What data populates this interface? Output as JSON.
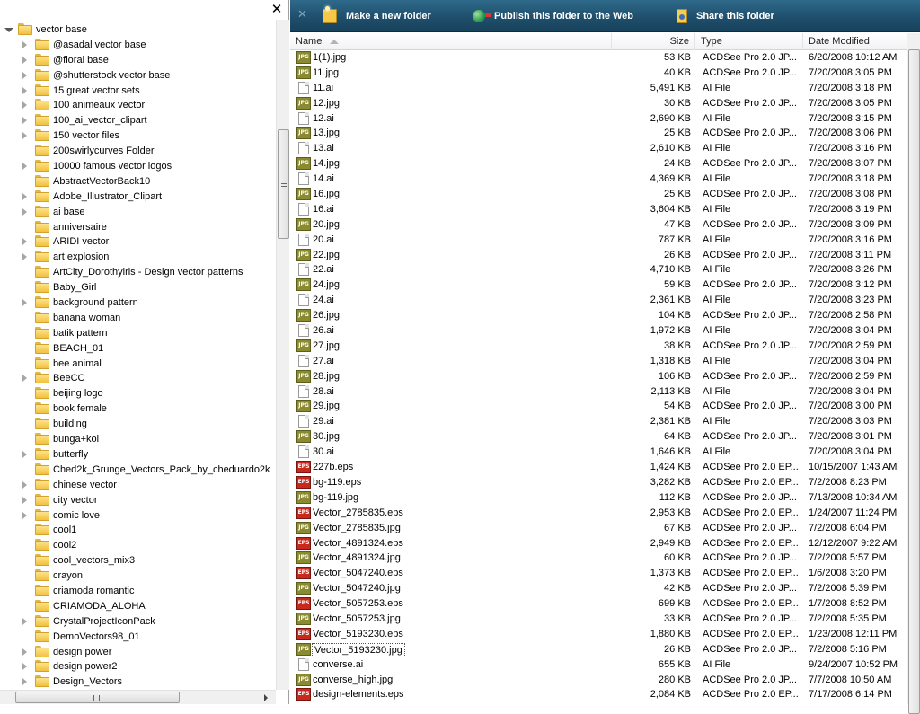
{
  "tree": {
    "close_glyph": "✕",
    "root_label": "vector base",
    "items": [
      {
        "label": "@asadal vector base",
        "expandable": true
      },
      {
        "label": "@floral base",
        "expandable": true
      },
      {
        "label": "@shutterstock vector base",
        "expandable": true
      },
      {
        "label": "15 great vector sets",
        "expandable": true
      },
      {
        "label": "100 animeaux vector",
        "expandable": true
      },
      {
        "label": "100_ai_vector_clipart",
        "expandable": true
      },
      {
        "label": "150 vector files",
        "expandable": true
      },
      {
        "label": "200swirlycurves Folder",
        "expandable": false
      },
      {
        "label": "10000 famous vector logos",
        "expandable": true
      },
      {
        "label": "AbstractVectorBack10",
        "expandable": false
      },
      {
        "label": "Adobe_Illustrator_Clipart",
        "expandable": true
      },
      {
        "label": "ai base",
        "expandable": true
      },
      {
        "label": "anniversaire",
        "expandable": false
      },
      {
        "label": "ARIDI vector",
        "expandable": true
      },
      {
        "label": "art explosion",
        "expandable": true
      },
      {
        "label": "ArtCity_Dorothyiris - Design vector patterns",
        "expandable": false
      },
      {
        "label": "Baby_Girl",
        "expandable": false
      },
      {
        "label": "background pattern",
        "expandable": true
      },
      {
        "label": "banana woman",
        "expandable": false
      },
      {
        "label": "batik pattern",
        "expandable": false
      },
      {
        "label": "BEACH_01",
        "expandable": false
      },
      {
        "label": "bee animal",
        "expandable": false
      },
      {
        "label": "BeeCC",
        "expandable": true
      },
      {
        "label": "beijing logo",
        "expandable": false
      },
      {
        "label": "book female",
        "expandable": false
      },
      {
        "label": "building",
        "expandable": false
      },
      {
        "label": "bunga+koi",
        "expandable": false
      },
      {
        "label": "butterfly",
        "expandable": true
      },
      {
        "label": "Ched2k_Grunge_Vectors_Pack_by_cheduardo2k",
        "expandable": false
      },
      {
        "label": "chinese vector",
        "expandable": true
      },
      {
        "label": "city vector",
        "expandable": true
      },
      {
        "label": "comic love",
        "expandable": true
      },
      {
        "label": "cool1",
        "expandable": false
      },
      {
        "label": "cool2",
        "expandable": false
      },
      {
        "label": "cool_vectors_mix3",
        "expandable": false
      },
      {
        "label": "crayon",
        "expandable": false
      },
      {
        "label": "criamoda romantic",
        "expandable": false
      },
      {
        "label": "CRIAMODA_ALOHA",
        "expandable": false
      },
      {
        "label": "CrystalProjectIconPack",
        "expandable": true
      },
      {
        "label": "DemoVectors98_01",
        "expandable": false
      },
      {
        "label": "design power",
        "expandable": true
      },
      {
        "label": "design power2",
        "expandable": true
      },
      {
        "label": "Design_Vectors",
        "expandable": true
      }
    ]
  },
  "command_bar": {
    "close_glyph": "✕",
    "items": [
      {
        "label": "Make a new folder",
        "icon": "new-folder-icon"
      },
      {
        "label": "Publish this folder to the Web",
        "icon": "publish-web-icon"
      },
      {
        "label": "Share this folder",
        "icon": "share-folder-icon"
      }
    ]
  },
  "columns": {
    "name": "Name",
    "size": "Size",
    "type": "Type",
    "date": "Date Modified"
  },
  "files": [
    {
      "name": "1(1).jpg",
      "icon": "jpg",
      "size": "53 KB",
      "type": "ACDSee Pro 2.0 JP...",
      "date": "6/20/2008 10:12 AM"
    },
    {
      "name": "11.jpg",
      "icon": "jpg",
      "size": "40 KB",
      "type": "ACDSee Pro 2.0 JP...",
      "date": "7/20/2008 3:05 PM"
    },
    {
      "name": "11.ai",
      "icon": "ai",
      "size": "5,491 KB",
      "type": "AI File",
      "date": "7/20/2008 3:18 PM"
    },
    {
      "name": "12.jpg",
      "icon": "jpg",
      "size": "30 KB",
      "type": "ACDSee Pro 2.0 JP...",
      "date": "7/20/2008 3:05 PM"
    },
    {
      "name": "12.ai",
      "icon": "ai",
      "size": "2,690 KB",
      "type": "AI File",
      "date": "7/20/2008 3:15 PM"
    },
    {
      "name": "13.jpg",
      "icon": "jpg",
      "size": "25 KB",
      "type": "ACDSee Pro 2.0 JP...",
      "date": "7/20/2008 3:06 PM"
    },
    {
      "name": "13.ai",
      "icon": "ai",
      "size": "2,610 KB",
      "type": "AI File",
      "date": "7/20/2008 3:16 PM"
    },
    {
      "name": "14.jpg",
      "icon": "jpg",
      "size": "24 KB",
      "type": "ACDSee Pro 2.0 JP...",
      "date": "7/20/2008 3:07 PM"
    },
    {
      "name": "14.ai",
      "icon": "ai",
      "size": "4,369 KB",
      "type": "AI File",
      "date": "7/20/2008 3:18 PM"
    },
    {
      "name": "16.jpg",
      "icon": "jpg",
      "size": "25 KB",
      "type": "ACDSee Pro 2.0 JP...",
      "date": "7/20/2008 3:08 PM"
    },
    {
      "name": "16.ai",
      "icon": "ai",
      "size": "3,604 KB",
      "type": "AI File",
      "date": "7/20/2008 3:19 PM"
    },
    {
      "name": "20.jpg",
      "icon": "jpg",
      "size": "47 KB",
      "type": "ACDSee Pro 2.0 JP...",
      "date": "7/20/2008 3:09 PM"
    },
    {
      "name": "20.ai",
      "icon": "ai",
      "size": "787 KB",
      "type": "AI File",
      "date": "7/20/2008 3:16 PM"
    },
    {
      "name": "22.jpg",
      "icon": "jpg",
      "size": "26 KB",
      "type": "ACDSee Pro 2.0 JP...",
      "date": "7/20/2008 3:11 PM"
    },
    {
      "name": "22.ai",
      "icon": "ai",
      "size": "4,710 KB",
      "type": "AI File",
      "date": "7/20/2008 3:26 PM"
    },
    {
      "name": "24.jpg",
      "icon": "jpg",
      "size": "59 KB",
      "type": "ACDSee Pro 2.0 JP...",
      "date": "7/20/2008 3:12 PM"
    },
    {
      "name": "24.ai",
      "icon": "ai",
      "size": "2,361 KB",
      "type": "AI File",
      "date": "7/20/2008 3:23 PM"
    },
    {
      "name": "26.jpg",
      "icon": "jpg",
      "size": "104 KB",
      "type": "ACDSee Pro 2.0 JP...",
      "date": "7/20/2008 2:58 PM"
    },
    {
      "name": "26.ai",
      "icon": "ai",
      "size": "1,972 KB",
      "type": "AI File",
      "date": "7/20/2008 3:04 PM"
    },
    {
      "name": "27.jpg",
      "icon": "jpg",
      "size": "38 KB",
      "type": "ACDSee Pro 2.0 JP...",
      "date": "7/20/2008 2:59 PM"
    },
    {
      "name": "27.ai",
      "icon": "ai",
      "size": "1,318 KB",
      "type": "AI File",
      "date": "7/20/2008 3:04 PM"
    },
    {
      "name": "28.jpg",
      "icon": "jpg",
      "size": "106 KB",
      "type": "ACDSee Pro 2.0 JP...",
      "date": "7/20/2008 2:59 PM"
    },
    {
      "name": "28.ai",
      "icon": "ai",
      "size": "2,113 KB",
      "type": "AI File",
      "date": "7/20/2008 3:04 PM"
    },
    {
      "name": "29.jpg",
      "icon": "jpg",
      "size": "54 KB",
      "type": "ACDSee Pro 2.0 JP...",
      "date": "7/20/2008 3:00 PM"
    },
    {
      "name": "29.ai",
      "icon": "ai",
      "size": "2,381 KB",
      "type": "AI File",
      "date": "7/20/2008 3:03 PM"
    },
    {
      "name": "30.jpg",
      "icon": "jpg",
      "size": "64 KB",
      "type": "ACDSee Pro 2.0 JP...",
      "date": "7/20/2008 3:01 PM"
    },
    {
      "name": "30.ai",
      "icon": "ai",
      "size": "1,646 KB",
      "type": "AI File",
      "date": "7/20/2008 3:04 PM"
    },
    {
      "name": "227b.eps",
      "icon": "eps",
      "size": "1,424 KB",
      "type": "ACDSee Pro 2.0 EP...",
      "date": "10/15/2007 1:43 AM"
    },
    {
      "name": "bg-119.eps",
      "icon": "eps",
      "size": "3,282 KB",
      "type": "ACDSee Pro 2.0 EP...",
      "date": "7/2/2008 8:23 PM"
    },
    {
      "name": "bg-119.jpg",
      "icon": "jpg",
      "size": "112 KB",
      "type": "ACDSee Pro 2.0 JP...",
      "date": "7/13/2008 10:34 AM"
    },
    {
      "name": "Vector_2785835.eps",
      "icon": "eps",
      "size": "2,953 KB",
      "type": "ACDSee Pro 2.0 EP...",
      "date": "1/24/2007 11:24 PM"
    },
    {
      "name": "Vector_2785835.jpg",
      "icon": "jpg",
      "size": "67 KB",
      "type": "ACDSee Pro 2.0 JP...",
      "date": "7/2/2008 6:04 PM"
    },
    {
      "name": "Vector_4891324.eps",
      "icon": "eps",
      "size": "2,949 KB",
      "type": "ACDSee Pro 2.0 EP...",
      "date": "12/12/2007 9:22 AM"
    },
    {
      "name": "Vector_4891324.jpg",
      "icon": "jpg",
      "size": "60 KB",
      "type": "ACDSee Pro 2.0 JP...",
      "date": "7/2/2008 5:57 PM"
    },
    {
      "name": "Vector_5047240.eps",
      "icon": "eps",
      "size": "1,373 KB",
      "type": "ACDSee Pro 2.0 EP...",
      "date": "1/6/2008 3:20 PM"
    },
    {
      "name": "Vector_5047240.jpg",
      "icon": "jpg",
      "size": "42 KB",
      "type": "ACDSee Pro 2.0 JP...",
      "date": "7/2/2008 5:39 PM"
    },
    {
      "name": "Vector_5057253.eps",
      "icon": "eps",
      "size": "699 KB",
      "type": "ACDSee Pro 2.0 EP...",
      "date": "1/7/2008 8:52 PM"
    },
    {
      "name": "Vector_5057253.jpg",
      "icon": "jpg",
      "size": "33 KB",
      "type": "ACDSee Pro 2.0 JP...",
      "date": "7/2/2008 5:35 PM"
    },
    {
      "name": "Vector_5193230.eps",
      "icon": "eps",
      "size": "1,880 KB",
      "type": "ACDSee Pro 2.0 EP...",
      "date": "1/23/2008 12:11 PM"
    },
    {
      "name": "Vector_5193230.jpg",
      "icon": "jpg",
      "size": "26 KB",
      "type": "ACDSee Pro 2.0 JP...",
      "date": "7/2/2008 5:16 PM",
      "focused": true
    },
    {
      "name": "converse.ai",
      "icon": "ai",
      "size": "655 KB",
      "type": "AI File",
      "date": "9/24/2007 10:52 PM"
    },
    {
      "name": "converse_high.jpg",
      "icon": "jpg",
      "size": "280 KB",
      "type": "ACDSee Pro 2.0 JP...",
      "date": "7/7/2008 10:50 AM"
    },
    {
      "name": "design-elements.eps",
      "icon": "eps",
      "size": "2,084 KB",
      "type": "ACDSee Pro 2.0 EP...",
      "date": "7/17/2008 6:14 PM"
    }
  ],
  "colors": {
    "command_bar_top": "#2f6a8a",
    "command_bar_bottom": "#17425c",
    "folder_yellow": "#f2c13e",
    "jpg_icon": "#8a8a2f",
    "eps_icon": "#c8291c"
  }
}
